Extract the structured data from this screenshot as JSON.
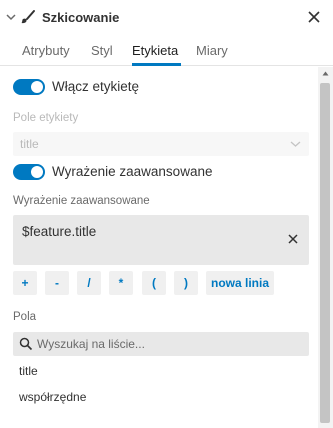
{
  "header": {
    "title": "Szkicowanie",
    "icons": [
      "chevron-down-icon",
      "brush-icon",
      "close-icon"
    ]
  },
  "tabs": [
    {
      "label": "Atrybuty",
      "active": false
    },
    {
      "label": "Styl",
      "active": false
    },
    {
      "label": "Etykieta",
      "active": true
    },
    {
      "label": "Miary",
      "active": false
    }
  ],
  "label_panel": {
    "enable_label": {
      "label": "Włącz etykietę",
      "on": true
    },
    "label_field": {
      "label": "Pole etykiety",
      "value": "title",
      "disabled": true
    },
    "advanced_expression": {
      "label": "Wyrażenie zaawansowane",
      "on": true
    },
    "expression_heading": "Wyrażenie zaawansowane",
    "expression_value": "$feature.title",
    "operators": [
      "+",
      "-",
      "/",
      "*",
      "(",
      ")",
      "nowa linia"
    ],
    "fields_heading": "Pola",
    "search_placeholder": "Wyszukaj na liście...",
    "fields": [
      "title",
      "współrzędne"
    ]
  },
  "colors": {
    "accent": "#0079c1",
    "text": "#323232",
    "muted": "#6a6a6a",
    "disabled": "#b9b9b9",
    "input_bg": "#e8e8e8"
  }
}
